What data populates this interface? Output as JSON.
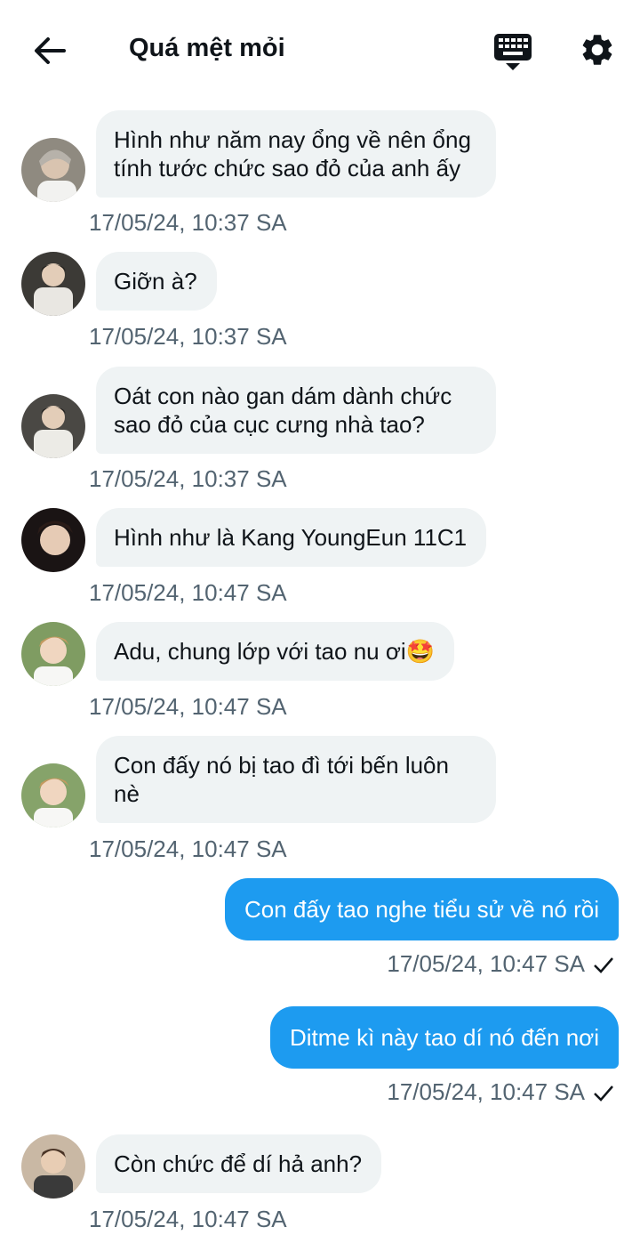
{
  "header": {
    "title": "Quá mệt mỏi",
    "back_icon": "arrow-left-icon",
    "keyboard_icon": "keyboard-icon",
    "settings_icon": "gear-icon"
  },
  "colors": {
    "incoming_bubble": "#eff3f4",
    "outgoing_bubble": "#1d9bf0",
    "timestamp": "#536471"
  },
  "messages": [
    {
      "direction": "incoming",
      "text": "Hình như năm nay ổng về nên ổng tính tước chức sao đỏ của anh ấy",
      "time": "17/05/24, 10:37 SA"
    },
    {
      "direction": "incoming",
      "text": "Giỡn à?",
      "time": "17/05/24, 10:37 SA"
    },
    {
      "direction": "incoming",
      "text": "Oát con nào gan dám dành chức sao đỏ của cục cưng nhà tao?",
      "time": "17/05/24, 10:37 SA"
    },
    {
      "direction": "incoming",
      "text": "Hình như là Kang YoungEun 11C1",
      "time": "17/05/24, 10:47 SA"
    },
    {
      "direction": "incoming",
      "text": "Adu, chung lớp với tao nu ơi🤩",
      "time": "17/05/24, 10:47 SA"
    },
    {
      "direction": "incoming",
      "text": "Con đấy nó bị tao đì tới bến luôn nè",
      "time": "17/05/24, 10:47 SA"
    },
    {
      "direction": "outgoing",
      "text": "Con đấy tao nghe tiểu sử về nó rồi",
      "time": "17/05/24, 10:47 SA",
      "status_icon": "check-icon"
    },
    {
      "direction": "outgoing",
      "text": "Ditme kì này tao dí nó đến nơi",
      "time": "17/05/24, 10:47 SA",
      "status_icon": "check-icon"
    },
    {
      "direction": "incoming",
      "text": "Còn chức để dí hả anh?",
      "time": "17/05/24, 10:47 SA"
    }
  ]
}
